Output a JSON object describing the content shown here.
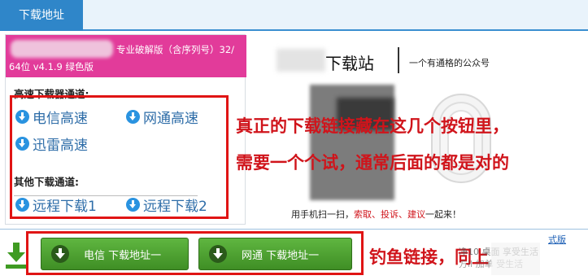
{
  "tab": {
    "label": "下载地址"
  },
  "product": {
    "line1": "专业破解版（含序列号）32/",
    "line2": "64位 v4.1.9 绿色版"
  },
  "sections": {
    "fast_title": "高速下载器通道:",
    "fast_links": [
      "电信高速",
      "网通高速",
      "迅雷高速"
    ],
    "other_title": "其他下载通道:",
    "other_links": [
      "远程下载1",
      "远程下载2"
    ]
  },
  "wechat": {
    "title": "下载站",
    "subtitle": "一个有通格的公众号",
    "scan_prefix": "用手机扫一扫，",
    "scan_red": "索取、投诉、建议",
    "scan_suffix": "一起来！"
  },
  "annotations": {
    "note1": "真正的下载链接藏在这几个按钮里，",
    "note2": "需要一个个试，通常后面的都是对的",
    "note3": "钓鱼链接，同上"
  },
  "bottom_buttons": [
    "电信 下载地址一",
    "网通 下载地址一"
  ],
  "ad": {
    "link": "式版",
    "line1": "净10 桌面 享受生活",
    "line2": "方ll  加单 受生活"
  },
  "colors": {
    "tab_blue": "#2f86c9",
    "pink": "#e23b9a",
    "link_blue": "#2e6da8",
    "annotation_red": "#d0141b",
    "button_green": "#4fa532"
  }
}
